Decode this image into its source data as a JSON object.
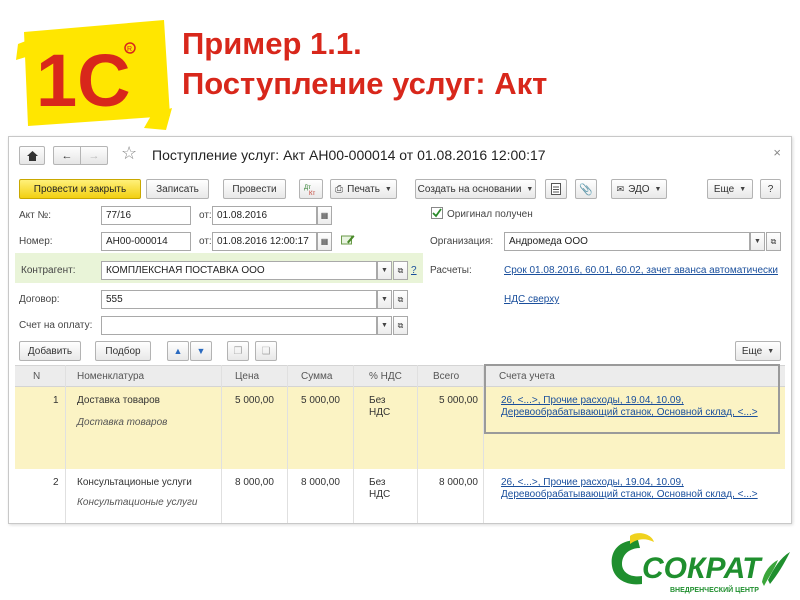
{
  "slide": {
    "title_line1": "Пример 1.1.",
    "title_line2": "Поступление услуг: Акт",
    "brand_1c": "1С",
    "brand_sokrat": "СОКРАТ",
    "brand_sokrat_sub": "ВНЕДРЕНЧЕСКИЙ ЦЕНТР"
  },
  "window": {
    "title": "Поступление услуг: Акт АН00-000014 от 01.08.2016 12:00:17",
    "close_glyph": "×"
  },
  "toolbar": {
    "post_and_close": "Провести и закрыть",
    "save": "Записать",
    "post": "Провести",
    "print": "Печать",
    "create_based_on": "Создать на основании",
    "edo": "ЭДО",
    "more": "Еще",
    "help": "?"
  },
  "form": {
    "act_no_label": "Акт №:",
    "act_no_value": "77/16",
    "from_label": "от:",
    "act_date": "01.08.2016",
    "number_label": "Номер:",
    "number_value": "АН00-000014",
    "number_date": "01.08.2016 12:00:17",
    "original_received": "Оригинал получен",
    "org_label": "Организация:",
    "org_value": "Андромеда ООО",
    "contractor_label": "Контрагент:",
    "contractor_value": "КОМПЛЕКСНАЯ ПОСТАВКА ООО",
    "contractor_help": "?",
    "settlements_label": "Расчеты:",
    "settlements_link": "Срок 01.08.2016, 60.01, 60.02, зачет аванса автоматически",
    "contract_label": "Договор:",
    "contract_value": "555",
    "vat_link": "НДС сверху",
    "invoice_label": "Счет на оплату:",
    "invoice_value": ""
  },
  "table_toolbar": {
    "add": "Добавить",
    "pick": "Подбор",
    "more": "Еще"
  },
  "table": {
    "columns": [
      "N",
      "Номенклатура",
      "Цена",
      "Сумма",
      "% НДС",
      "Всего",
      "Счета учета"
    ],
    "rows": [
      {
        "n": "1",
        "item": "Доставка товаров",
        "item_content": "Доставка товаров",
        "price": "5 000,00",
        "sum": "5 000,00",
        "vat_line1": "Без",
        "vat_line2": "НДС",
        "total": "5 000,00",
        "accounts_line1": "26, <...>, Прочие расходы, 19.04, 10.09,",
        "accounts_line2": "Деревообрабатывающий станок, Основной склад, <...>"
      },
      {
        "n": "2",
        "item": "Консультационые услуги",
        "item_content": "Консультационые услуги",
        "price": "8 000,00",
        "sum": "8 000,00",
        "vat_line1": "Без",
        "vat_line2": "НДС",
        "total": "8 000,00",
        "accounts_line1": "26, <...>, Прочие расходы, 19.04, 10.09,",
        "accounts_line2": "Деревообрабатывающий станок, Основной склад, <...>"
      }
    ]
  },
  "colors": {
    "title_red": "#d8271b",
    "logo_yellow": "#ffe600",
    "primary_button": "#f2d012",
    "link_blue": "#1a4f9c",
    "selected_row": "#fbf3c4",
    "contractor_row": "#e9f4d8",
    "sokrat_green": "#1f8f2e"
  }
}
